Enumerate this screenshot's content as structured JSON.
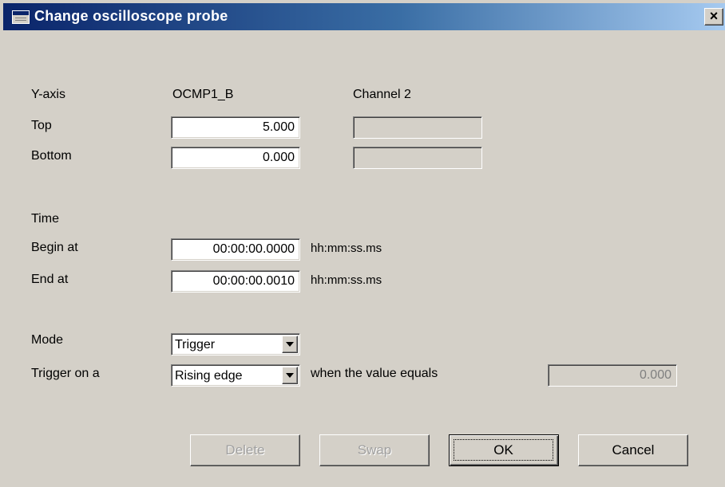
{
  "window": {
    "title": "Change oscilloscope probe",
    "close_glyph": "×"
  },
  "yaxis": {
    "label": "Y-axis",
    "channel1": "OCMP1_B",
    "channel2": "Channel 2",
    "top_label": "Top",
    "top_value": "5.000",
    "top_value_ch2": "",
    "bottom_label": "Bottom",
    "bottom_value": "0.000",
    "bottom_value_ch2": ""
  },
  "time": {
    "label": "Time",
    "begin_label": "Begin at",
    "begin_value": "00:00:00.0000",
    "end_label": "End at",
    "end_value": "00:00:00.0010",
    "format_hint": "hh:mm:ss.ms"
  },
  "mode": {
    "label": "Mode",
    "selected": "Trigger",
    "trigger_label": "Trigger on a",
    "trigger_selected": "Rising edge",
    "condition_text": "when the value equals",
    "trigger_value": "0.000"
  },
  "buttons": {
    "delete": "Delete",
    "swap": "Swap",
    "ok": "OK",
    "cancel": "Cancel"
  },
  "icons": {
    "window_icon": "dialog-window-icon",
    "close": "close-icon",
    "dropdown": "chevron-down-icon"
  }
}
